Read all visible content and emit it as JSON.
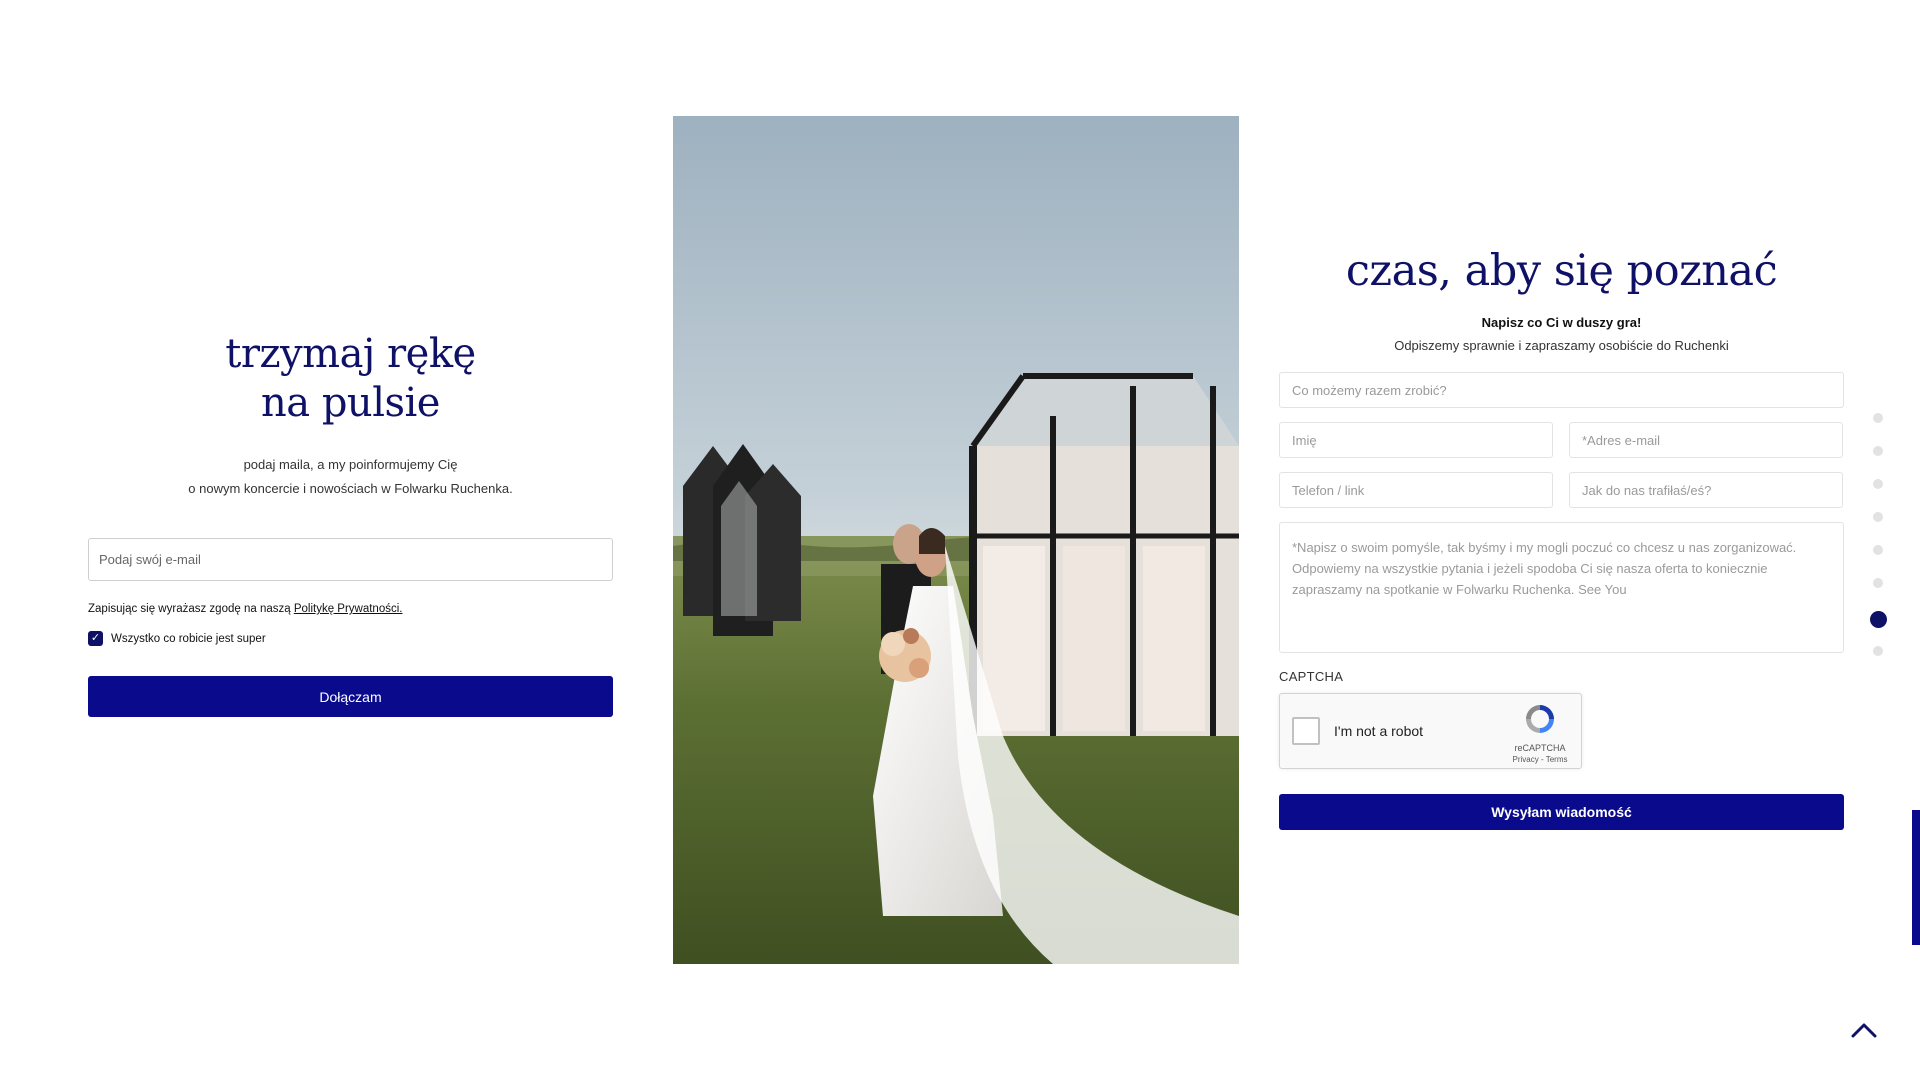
{
  "newsletter": {
    "title_line1": "trzymaj rękę",
    "title_line2": "na pulsie",
    "subtitle_line1": "podaj maila, a my poinformujemy Cię",
    "subtitle_line2": "o nowym koncercie i nowościach w Folwarku Ruchenka.",
    "email_placeholder": "Podaj swój e-mail",
    "consent_text": "Zapisując się wyrażasz zgodę na naszą ",
    "consent_link": "Politykę Prywatności.",
    "checkbox_label": "Wszystko co robicie jest super",
    "checkbox_checked": true,
    "button_label": "Dołączam"
  },
  "contact": {
    "title": "czas, aby się poznać",
    "bold_text": "Napisz co Ci w duszy gra!",
    "subtitle": "Odpiszemy sprawnie i zapraszamy osobiście do Ruchenki",
    "topic_placeholder": "Co możemy razem zrobić?",
    "name_placeholder": "Imię",
    "email_placeholder": "*Adres e-mail",
    "phone_placeholder": "Telefon / link",
    "source_placeholder": "Jak do nas trafiłaś/eś?",
    "message_placeholder": "*Napisz o swoim pomyśle, tak byśmy i my mogli poczuć co chcesz u nas zorganizować. Odpowiemy na wszystkie pytania i jeżeli spodoba Ci się nasza oferta to koniecznie zapraszamy na spotkanie w Folwarku Ruchenka. See You",
    "captcha_label": "CAPTCHA",
    "recaptcha_label": "I'm not a robot",
    "recaptcha_brand": "reCAPTCHA",
    "recaptcha_links": "Privacy - Terms",
    "button_label": "Wysyłam wiadomość"
  },
  "dot_nav": {
    "count": 8,
    "active_index": 6
  },
  "colors": {
    "accent": "#0a0a8c",
    "heading": "#0e1166"
  },
  "icons": {
    "back_to_top": "chevron-up-icon",
    "recaptcha": "recaptcha-logo-icon",
    "checkbox": "check-icon"
  }
}
